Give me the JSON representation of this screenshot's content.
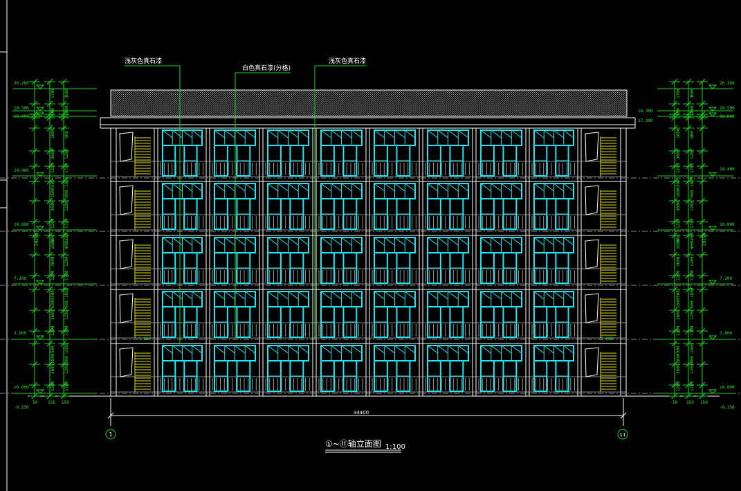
{
  "drawing": {
    "title": "①~⑪轴立面图",
    "scale": "1:100",
    "axis_start": "1",
    "axis_end": "11",
    "overall_width": "34400"
  },
  "callouts": [
    {
      "label": "浅灰色真石漆"
    },
    {
      "label": "白色真石漆(分格)"
    },
    {
      "label": "浅灰色真石漆"
    }
  ],
  "elevations_left": [
    "20.200",
    "18.500",
    "18.000",
    "14.400",
    "10.800",
    "7.200",
    "3.600",
    "±0.000",
    "-0.150"
  ],
  "elevations_right": [
    "20.200",
    "18.500",
    "18.000",
    "14.400",
    "10.800",
    "7.200",
    "3.600",
    "±0.000",
    "-0.150"
  ],
  "roof_marks": [
    "18.300",
    "17.300"
  ],
  "total_height": "20350",
  "floor_dims": [
    "1700",
    "500",
    "3600",
    "1800",
    "1200",
    "600"
  ],
  "bottom_dims": [
    "150",
    "50"
  ],
  "stair_marks": [
    "3.600",
    "3.600"
  ],
  "colors": {
    "grid": "#1fd21f",
    "window": "#1fe6f0",
    "stair": "#e8e000",
    "line": "#ffffff"
  }
}
